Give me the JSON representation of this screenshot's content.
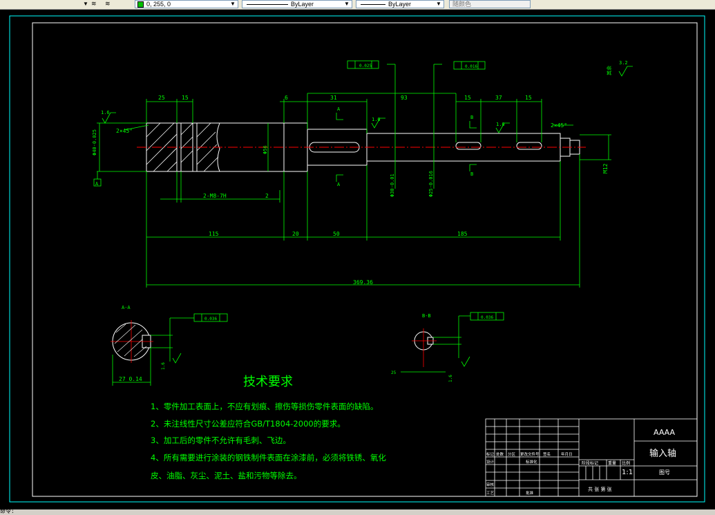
{
  "toolbar": {
    "color_value": "0, 255, 0",
    "linetype": "ByLayer",
    "lineweight": "ByLayer",
    "plotstyle": "随颜色"
  },
  "drawing": {
    "title_block": {
      "company": "AAAA",
      "part_name": "输入轴",
      "scale": "1:1",
      "drawing_no_label": "图号",
      "sheet_label": "共 张 第 张",
      "headers": [
        "标记",
        "处数",
        "分区",
        "更改文件号",
        "签名",
        "年月日"
      ],
      "designer_label": "设计",
      "standardization_label": "标准化",
      "review_label": "审核",
      "process_label": "工艺",
      "approve_label": "批准",
      "stage_label": "阶段标记",
      "weight_label": "重量",
      "ratio_label": "比例"
    },
    "tech_requirements": {
      "title": "技术要求",
      "lines": [
        "1、零件加工表面上，不应有划痕、擦伤等损伤零件表面的缺陷。",
        "2、未注线性尺寸公差应符合GB/T1804-2000的要求。",
        "3、加工后的零件不允许有毛刺、飞边。",
        "4、所有需要进行涂装的钢铁制件表面在涂漆前，必须将铁锈、氧化",
        "皮、油脂、灰尘、泥土、盐和污物等除去。"
      ]
    },
    "dims": {
      "d25": "25",
      "d15a": "15",
      "d6": "6",
      "d31": "31",
      "d93": "93",
      "d15b": "15",
      "d37": "37",
      "d15c": "15",
      "d115": "115",
      "d20": "20",
      "d50": "50",
      "d185": "185",
      "d369": "369.36",
      "d2": "2",
      "m8": "2-M8-7H",
      "d2b": "2",
      "chamfer1": "2×45°",
      "chamfer2": "2×45°",
      "dia40": "Φ40-0.025",
      "dia56": "Φ56",
      "dia30": "Φ30-0.01",
      "dia25": "Φ25-0.016",
      "m12": "M12",
      "dim27": "27 0.14",
      "ra16": "1.6",
      "ra16b": "1.6",
      "ra16c": "1.6",
      "ra_other": "其余",
      "ra32": "3.2",
      "tol1": "0.025",
      "tol2": "0.016",
      "tol3": "0.036",
      "tol4": "0.036",
      "datumA": "A",
      "secAA": "A-A",
      "secBB": "B-B",
      "labelA1": "A",
      "labelA2": "A",
      "labelB1": "B",
      "labelB2": "B"
    }
  },
  "status": {
    "command_prompt": "命令:"
  }
}
